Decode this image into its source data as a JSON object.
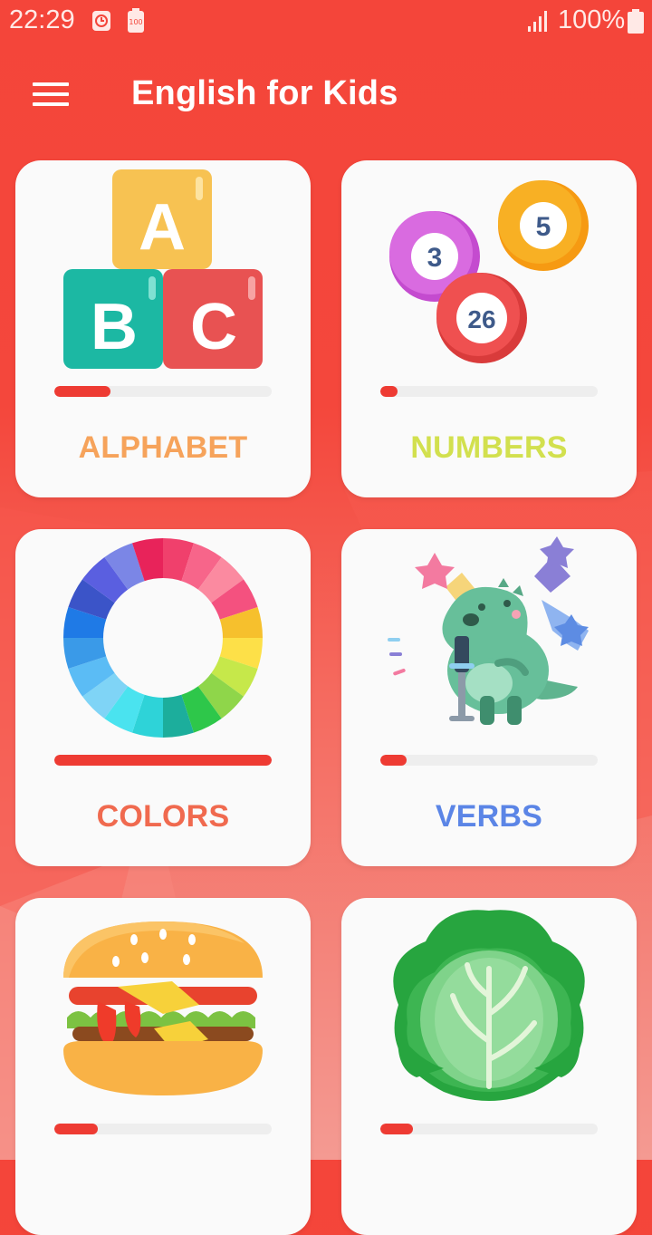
{
  "status": {
    "time": "22:29",
    "battery": "100%",
    "icons": [
      "alarm-icon",
      "battery-saver-icon",
      "signal-icon",
      "battery-icon"
    ]
  },
  "app": {
    "title": "English for Kids",
    "menu_icon": "hamburger-menu-icon"
  },
  "categories": [
    {
      "label": "ALPHABET",
      "color": "#f6a35b",
      "progress": 0.26,
      "icon": "abc-blocks-icon"
    },
    {
      "label": "NUMBERS",
      "color": "#d2e04e",
      "progress": 0.08,
      "icon": "number-balls-icon"
    },
    {
      "label": "COLORS",
      "color": "#f06a4f",
      "progress": 1.0,
      "icon": "color-wheel-icon"
    },
    {
      "label": "VERBS",
      "color": "#5b85e6",
      "progress": 0.12,
      "icon": "singing-dinosaur-icon"
    },
    {
      "label": "",
      "color": "#f06a4f",
      "progress": 0.2,
      "icon": "burger-icon"
    },
    {
      "label": "",
      "color": "#5b85e6",
      "progress": 0.15,
      "icon": "cabbage-icon"
    }
  ],
  "ball_numbers": {
    "a": "3",
    "b": "5",
    "c": "26"
  },
  "block_letters": {
    "a": "A",
    "b": "B",
    "c": "C"
  },
  "theme": {
    "primary": "#f4453a",
    "progress_fill": "#ee3b33",
    "card_bg": "#fafafa"
  }
}
